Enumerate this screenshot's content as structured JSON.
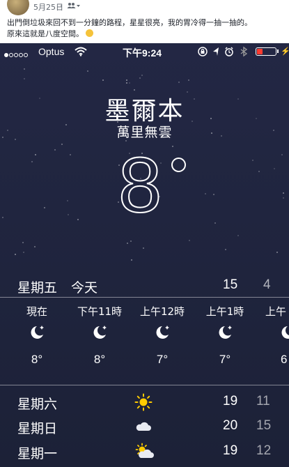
{
  "post": {
    "date": "5月25日",
    "separator": "·",
    "text_line1": "出門倒垃圾來回不到一分鐘的路程，星星很亮，我的胃冷得一抽一抽的。",
    "text_line2": "原來這就是八度空間。"
  },
  "status_bar": {
    "carrier": "Optus",
    "time": "下午9:24",
    "signal_dots_filled": 1,
    "signal_dots_total": 5,
    "battery_level_percent": 15,
    "battery_color": "#ff3b30"
  },
  "weather": {
    "city": "墨爾本",
    "condition": "萬里無雲",
    "current_temp": "8"
  },
  "today": {
    "day": "星期五",
    "label": "今天",
    "high": "15",
    "low": "4"
  },
  "hourly": [
    {
      "label": "現在",
      "icon": "moon-stars-icon",
      "temp": "8°"
    },
    {
      "label": "下午11時",
      "icon": "moon-stars-icon",
      "temp": "8°"
    },
    {
      "label": "上午12時",
      "icon": "moon-stars-icon",
      "temp": "7°"
    },
    {
      "label": "上午1時",
      "icon": "moon-stars-icon",
      "temp": "7°"
    },
    {
      "label": "上午",
      "icon": "moon-stars-icon",
      "temp": "6"
    }
  ],
  "daily": [
    {
      "day": "星期六",
      "icon": "sun-icon",
      "high": "19",
      "low": "11"
    },
    {
      "day": "星期日",
      "icon": "cloud-icon",
      "high": "20",
      "low": "15"
    },
    {
      "day": "星期一",
      "icon": "partly-cloudy-icon",
      "high": "19",
      "low": "12"
    }
  ],
  "colors": {
    "sky_top": "#232744",
    "sky_bottom": "#1c2137",
    "sun": "#ffcc00"
  }
}
